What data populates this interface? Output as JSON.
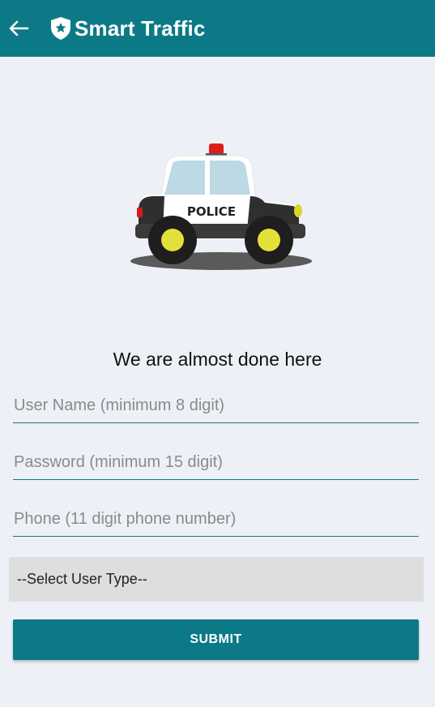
{
  "appbar": {
    "title": "Smart Traffic",
    "back_icon": "arrow-left-icon",
    "logo_icon": "shield-star-icon",
    "color": "#0b7a86"
  },
  "hero": {
    "icon": "police-car-illustration",
    "car_label": "POLICE"
  },
  "form": {
    "heading": "We are almost done here",
    "username": {
      "placeholder": "User Name (minimum 8 digit)",
      "value": ""
    },
    "password": {
      "placeholder": "Password (minimum 15 digit)",
      "value": ""
    },
    "phone": {
      "placeholder": "Phone (11 digit phone number)",
      "value": ""
    },
    "user_type": {
      "selected": "--Select User Type--"
    },
    "submit_label": "SUBMIT"
  }
}
